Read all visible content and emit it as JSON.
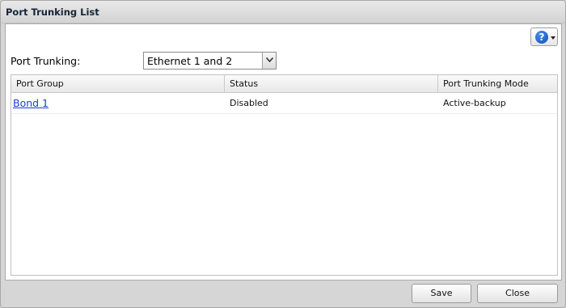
{
  "dialog": {
    "title": "Port Trunking List"
  },
  "help": {
    "icon": "help-icon",
    "glyph": "?"
  },
  "port_trunking": {
    "label": "Port Trunking:",
    "selected": "Ethernet 1 and 2"
  },
  "table": {
    "columns": [
      "Port Group",
      "Status",
      "Port Trunking Mode"
    ],
    "rows": [
      {
        "port_group": "Bond 1",
        "status": "Disabled",
        "mode": "Active-backup"
      }
    ]
  },
  "buttons": {
    "save": "Save",
    "close": "Close"
  }
}
